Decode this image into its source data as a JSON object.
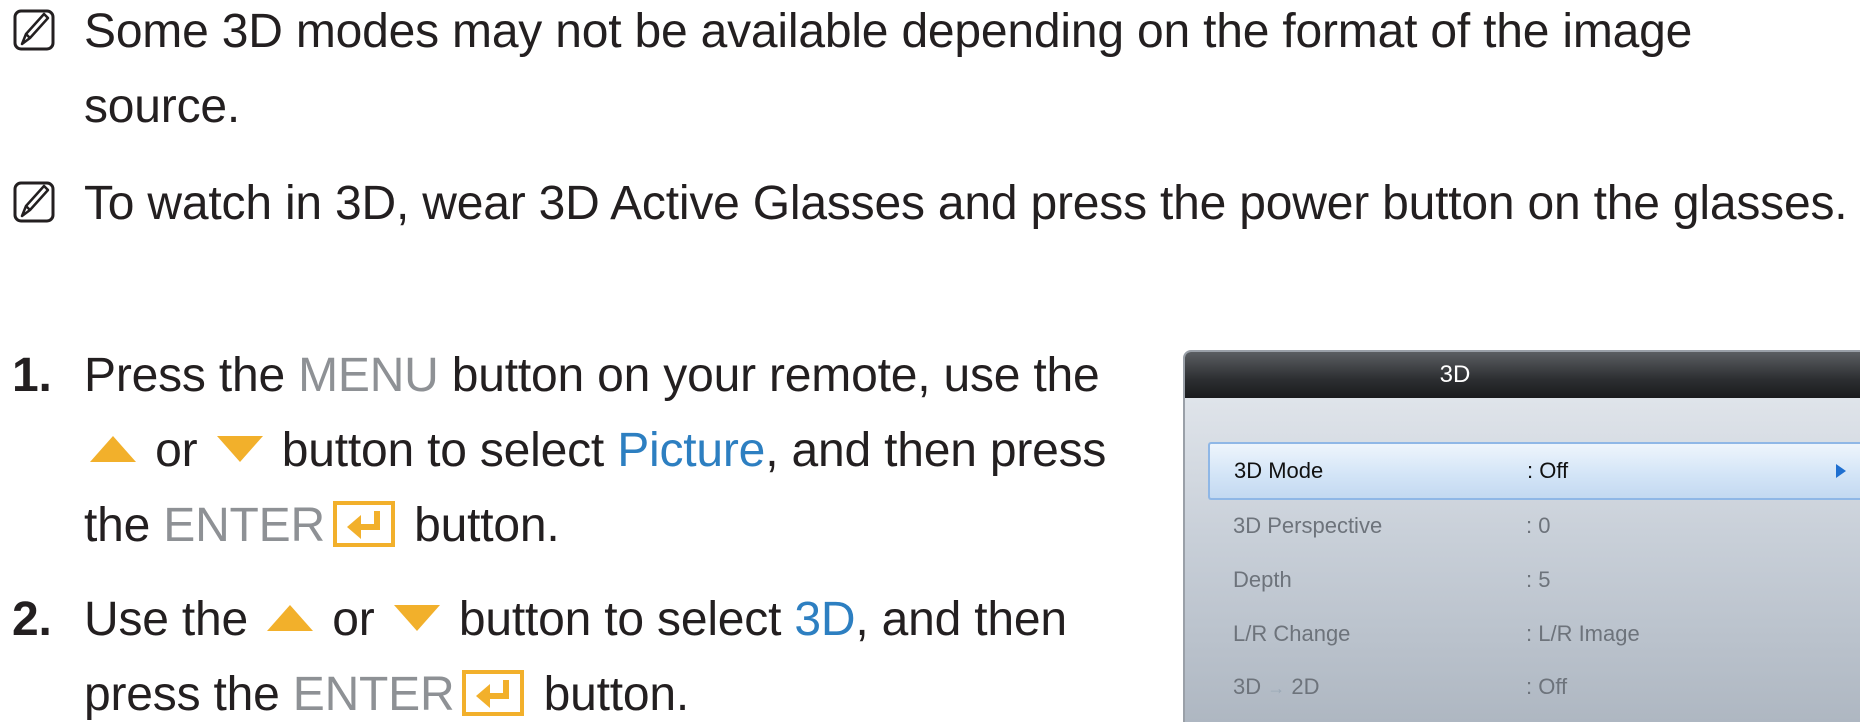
{
  "notes": [
    {
      "icon": "note-icon",
      "text": "Some 3D modes may not be available depending on the format of the image source."
    },
    {
      "icon": "note-icon",
      "text": "To watch in 3D, wear 3D Active Glasses and press the power button on the glasses."
    }
  ],
  "steps": [
    {
      "number": "1.",
      "t1": "Press the ",
      "kw_menu": "MENU",
      "t2": " button on your remote, use the ",
      "t3": " or ",
      "t4": " button to select ",
      "kw_target": "Picture",
      "t5": ", and then press the ",
      "kw_enter": "ENTER",
      "t6": " button."
    },
    {
      "number": "2.",
      "t1": "Use the ",
      "t3": " or ",
      "t4": " button to select ",
      "kw_target": "3D",
      "t5": ", and then press the ",
      "kw_enter": "ENTER",
      "t6": " button."
    }
  ],
  "icons": {
    "up": "up-triangle-icon",
    "down": "down-triangle-icon",
    "enter": "enter-icon",
    "note": "note-icon"
  },
  "colors": {
    "keyword_gray": "#8e9195",
    "keyword_blue": "#2d7fc1",
    "triangle": "#f2b02b"
  },
  "osd": {
    "title": "3D",
    "rows": [
      {
        "label": "3D Mode",
        "value": ": Off",
        "selected": true
      },
      {
        "label": "3D Perspective",
        "value": ": 0",
        "selected": false
      },
      {
        "label": "Depth",
        "value": ": 5",
        "selected": false
      },
      {
        "label": "L/R Change",
        "value": ": L/R Image",
        "selected": false
      },
      {
        "label_a": "3D",
        "label_arrow": "→",
        "label_b": "2D",
        "value": ": Off",
        "selected": false
      }
    ]
  }
}
